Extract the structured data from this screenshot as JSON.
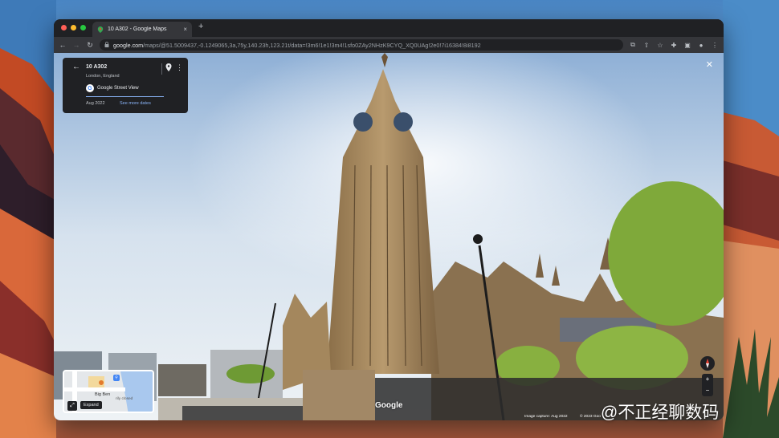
{
  "browser": {
    "tab_title": "10 A302 - Google Maps",
    "tab_close": "×",
    "new_tab": "+",
    "url_host": "google.com",
    "url_path": "/maps/@51.5009437,-0.1249065,3a,75y,140.23h,123.21t/data=!3m6!1e1!3m4!1sfo0ZAy2NHzK9CYQ_XQ0UAg!2e0!7i16384!8i8192"
  },
  "place_card": {
    "name": "10 A302",
    "location": "London, England",
    "source": "Google Street View",
    "date": "Aug 2022",
    "see_more": "See more dates"
  },
  "minimap": {
    "landmark": "Big Ben",
    "status_partial": "rily closed",
    "expand_label": "Expand"
  },
  "footer": {
    "brand": "Google",
    "capture": "Image capture: Aug 2022",
    "copyright": "© 2023 Goo"
  },
  "watermark": "@不正经聊数码",
  "colors": {
    "accent_link": "#8ab4f8",
    "panel": "#202124",
    "toolbar": "#35363a"
  }
}
